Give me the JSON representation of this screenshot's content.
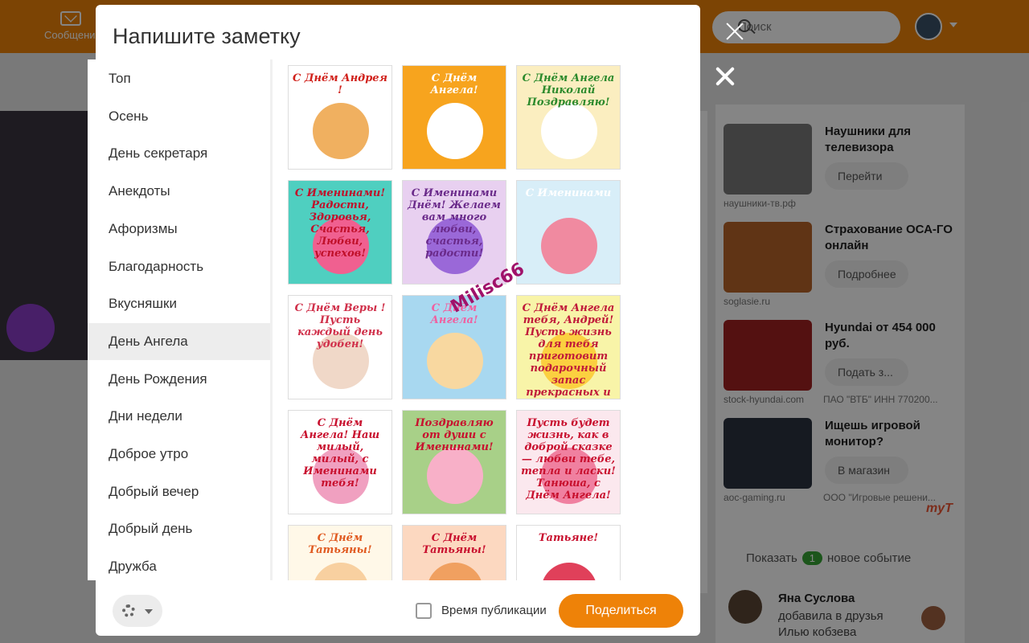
{
  "background": {
    "messages_label": "Сообщения",
    "search_placeholder": "Поиск",
    "ads": [
      {
        "title": "Наушники для телевизора",
        "button": "Перейти",
        "caption": "наушники-тв.рф",
        "caption2": "",
        "color": "#7a7a7a"
      },
      {
        "title": "Страхование ОСА-ГО онлайн",
        "button": "Подробнее",
        "caption": "soglasie.ru",
        "caption2": "",
        "color": "#b8642a"
      },
      {
        "title": "Hyundai от 454 000 руб.",
        "button": "Подать з...",
        "caption": "stock-hyundai.com",
        "caption2": "ПАО \"ВТБ\" ИНН 770200...",
        "color": "#a22222"
      },
      {
        "title": "Ищешь игровой монитор?",
        "button": "В магазин",
        "caption": "aoc-gaming.ru",
        "caption2": "ООО \"Игровые решени...",
        "color": "#2b3340"
      }
    ],
    "ad_mark": "myT",
    "show_label": "Показать",
    "event_count": "1",
    "event_label": "новое событие",
    "friend": {
      "name": "Яна Суслова",
      "line1": "добавила в друзья",
      "line2": "Илью кобзева"
    }
  },
  "dialog": {
    "title": "Напишите заметку",
    "publish_time_label": "Время публикации",
    "share_label": "Поделиться"
  },
  "picker": {
    "categories": [
      {
        "label": "Топ",
        "active": false
      },
      {
        "label": "Осень",
        "active": false
      },
      {
        "label": "День секретаря",
        "active": false
      },
      {
        "label": "Анекдоты",
        "active": false
      },
      {
        "label": "Афоризмы",
        "active": false
      },
      {
        "label": "Благодарность",
        "active": false
      },
      {
        "label": "Вкусняшки",
        "active": false
      },
      {
        "label": "День Ангела",
        "active": true
      },
      {
        "label": "День Рождения",
        "active": false
      },
      {
        "label": "Дни недели",
        "active": false
      },
      {
        "label": "Доброе утро",
        "active": false
      },
      {
        "label": "Добрый вечер",
        "active": false
      },
      {
        "label": "Добрый день",
        "active": false
      },
      {
        "label": "Дружба",
        "active": false
      }
    ],
    "cards": [
      {
        "text": "С Днём Андрея !",
        "bg": "#ffffff",
        "fg": "#d0201a",
        "accent": "#f0b060"
      },
      {
        "text": "С Днём Ангела!",
        "bg": "#f7a41e",
        "fg": "#ffffff",
        "accent": "#ffffff"
      },
      {
        "text": "С Днём Ангела Николай Поздравляю!",
        "bg": "#fbeec0",
        "fg": "#2c8a2c",
        "accent": "#ffffff"
      },
      {
        "text": "С Именинами! Радости, Здоровья, Счастья, Любви, успехов!",
        "bg": "#4fcfc0",
        "fg": "#c0102a",
        "accent": "#f06090"
      },
      {
        "text": "С Именинами Днём! Желаем вам много любви, счастья, радости!",
        "bg": "#e8d0f0",
        "fg": "#6a2a8a",
        "accent": "#9a68d8"
      },
      {
        "text": "С Именинами",
        "bg": "#d8eef8",
        "fg": "#ffffff",
        "accent": "#f08aa0"
      },
      {
        "text": "С Днём Веры ! Пусть каждый день удобен!",
        "bg": "#ffffff",
        "fg": "#d0304a",
        "accent": "#f0d8c8"
      },
      {
        "text": "С Днём Ангела!",
        "bg": "#a8d8f0",
        "fg": "#f060a0",
        "accent": "#f8d8a0"
      },
      {
        "text": "С Днём Ангела тебя, Андрей! Пусть жизнь для тебя приготовит подарочный запас прекрасных и счастья!",
        "bg": "#f8f4a8",
        "fg": "#c01a3a",
        "accent": "#fbd040"
      },
      {
        "text": "С Днём Ангела! Наш милый, милый, с Именинами тебя!",
        "bg": "#ffffff",
        "fg": "#c8102e",
        "accent": "#f0a0c0"
      },
      {
        "text": "Поздравляю от души с Именинами!",
        "bg": "#a8d088",
        "fg": "#c8102e",
        "accent": "#f8b0c8"
      },
      {
        "text": "Пусть будет жизнь, как в доброй сказке — любви тебе, тепла и ласки! Танюша, с Днём Ангела!",
        "bg": "#fbe8ee",
        "fg": "#c8102e",
        "accent": "#f080a0"
      },
      {
        "text": "С Днём Татьяны!",
        "bg": "#fff8e8",
        "fg": "#e05a20",
        "accent": "#f8d0a0"
      },
      {
        "text": "С Днём Татьяны!",
        "bg": "#fcd8c0",
        "fg": "#c8102e",
        "accent": "#f0a060"
      },
      {
        "text": "Татьяне!",
        "bg": "#ffffff",
        "fg": "#c8102e",
        "accent": "#e0405a"
      }
    ],
    "watermark": "Milisc66"
  }
}
